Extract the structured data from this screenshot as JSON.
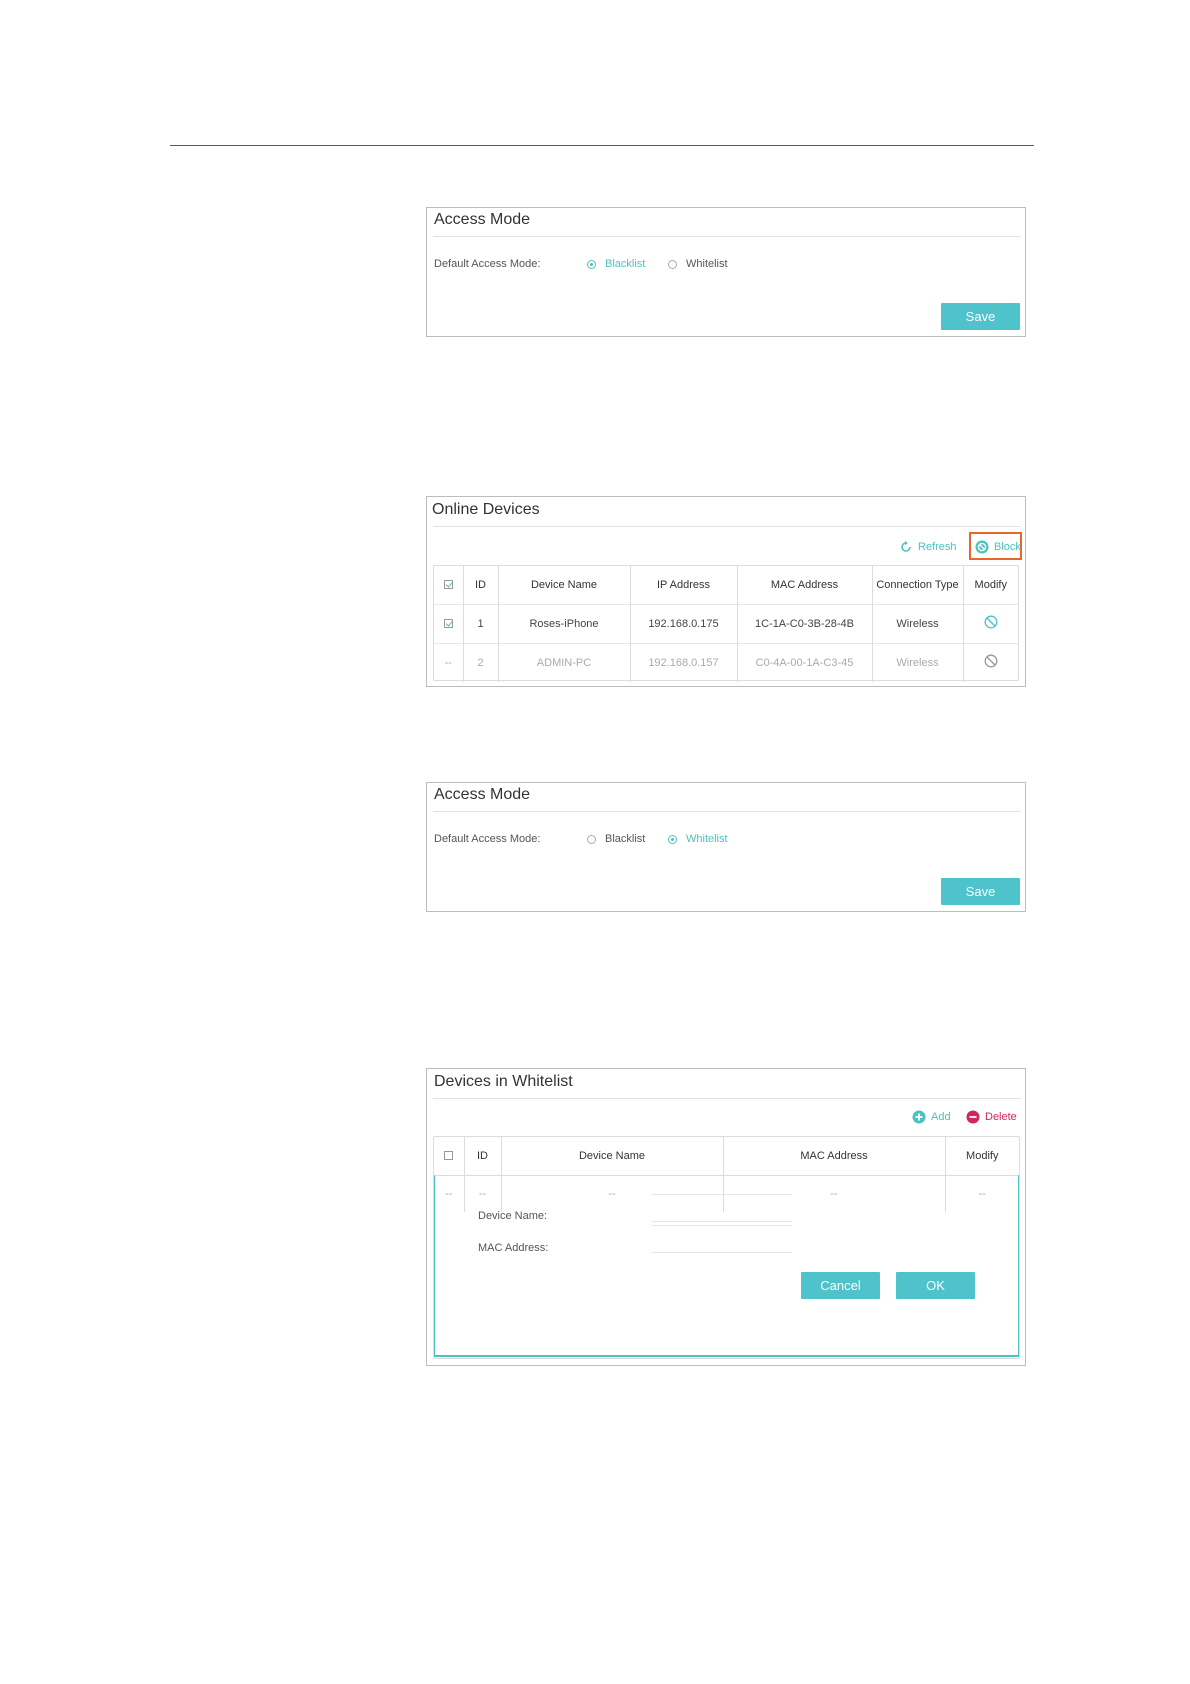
{
  "access_mode_1": {
    "title": "Access Mode",
    "label": "Default Access Mode:",
    "options": [
      "Blacklist",
      "Whitelist"
    ],
    "selected": "Blacklist",
    "save": "Save"
  },
  "online_devices": {
    "title": "Online Devices",
    "refresh": "Refresh",
    "block": "Block",
    "columns": [
      "ID",
      "Device Name",
      "IP Address",
      "MAC Address",
      "Connection Type",
      "Modify"
    ],
    "rows": [
      {
        "id": "1",
        "name": "Roses-iPhone",
        "ip": "192.168.0.175",
        "mac": "1C-1A-C0-3B-28-4B",
        "type": "Wireless",
        "checked": true
      },
      {
        "id": "2",
        "name": "ADMIN-PC",
        "ip": "192.168.0.157",
        "mac": "C0-4A-00-1A-C3-45",
        "type": "Wireless",
        "checked": false
      }
    ],
    "highlight_color": "#e8662c"
  },
  "access_mode_2": {
    "title": "Access Mode",
    "label": "Default Access Mode:",
    "options": [
      "Blacklist",
      "Whitelist"
    ],
    "selected": "Whitelist",
    "save": "Save"
  },
  "whitelist": {
    "title": "Devices in Whitelist",
    "add": "Add",
    "delete": "Delete",
    "columns": [
      "ID",
      "Device Name",
      "MAC Address",
      "Modify"
    ],
    "placeholder_row": [
      "--",
      "--",
      "--",
      "--",
      "--"
    ],
    "form": {
      "device_name_label": "Device Name:",
      "mac_label": "MAC Address:",
      "cancel": "Cancel",
      "ok": "OK"
    }
  },
  "colors": {
    "accent": "#4cc2c0",
    "button": "#4ec3cb",
    "delete": "#d0285c"
  }
}
